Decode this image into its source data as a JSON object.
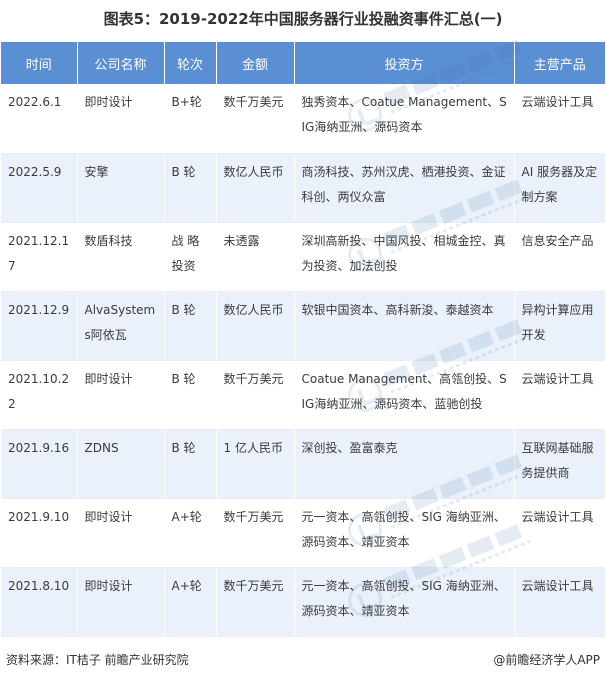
{
  "title": "图表5：2019-2022年中国服务器行业投融资事件汇总(一)",
  "columns": [
    "时间",
    "公司名称",
    "轮次",
    "金额",
    "投资方",
    "主营产品"
  ],
  "rows": [
    {
      "date": "2022.6.1",
      "company": "即时设计",
      "round": "B+轮",
      "amount": "数千万美元",
      "investors": "独秀资本、Coatue Management、SIG海纳亚洲、源码资本",
      "product": "云端设计工具"
    },
    {
      "date": "2022.5.9",
      "company": "安擎",
      "round": "B 轮",
      "amount": "数亿人民币",
      "investors": "商汤科技、苏州汉虎、栖港投资、金证科创、两仪众富",
      "product": "AI 服务器及定制方案"
    },
    {
      "date": "2021.12.17",
      "company": "数盾科技",
      "round": "战 略 投资",
      "amount": "未透露",
      "investors": "深圳高新投、中国风投、相城金控、真为投资、加法创投",
      "product": "信息安全产品"
    },
    {
      "date": "2021.12.9",
      "company": "AlvaSystems阿依瓦",
      "round": "B 轮",
      "amount": "数亿人民币",
      "investors": "软银中国资本、高科新浚、泰越资本",
      "product": "异构计算应用开发"
    },
    {
      "date": "2021.10.22",
      "company": "即时设计",
      "round": "B 轮",
      "amount": "数千万美元",
      "investors": "Coatue Management、高瓴创投、SIG海纳亚洲、源码资本、蓝驰创投",
      "product": "云端设计工具"
    },
    {
      "date": "2021.9.16",
      "company": "ZDNS",
      "round": "B 轮",
      "amount": "1 亿人民币",
      "investors": "深创投、盈富泰克",
      "product": "互联网基础服务提供商"
    },
    {
      "date": "2021.9.10",
      "company": "即时设计",
      "round": "A+轮",
      "amount": "数千万美元",
      "investors": "元一资本、高瓴创投、SIG 海纳亚洲、源码资本、靖亚资本",
      "product": "云端设计工具"
    },
    {
      "date": "2021.8.10",
      "company": "即时设计",
      "round": "A+轮",
      "amount": "数千万美元",
      "investors": "元一资本、高瓴创投、SIG 海纳亚洲、源码资本、靖亚资本",
      "product": "云端设计工具"
    }
  ],
  "footer": {
    "source": "资料来源：IT桔子 前瞻产业研究院",
    "brand": "@前瞻经济学人APP"
  },
  "colors": {
    "header_bg": "#5b8fd3",
    "stripe_bg": "#eaf1fa"
  }
}
